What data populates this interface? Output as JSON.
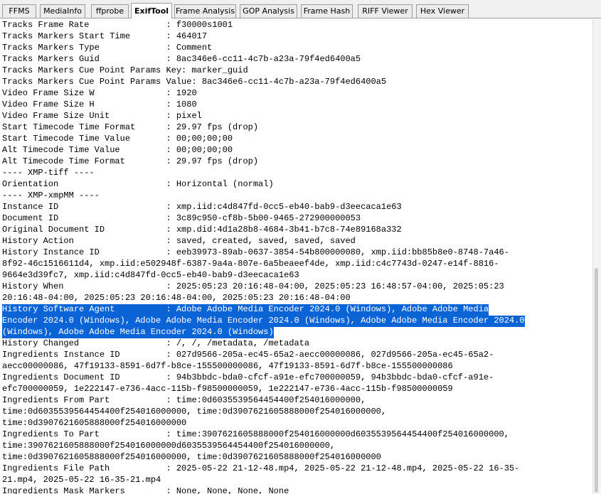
{
  "tabs": [
    {
      "label": "FFMS",
      "active": false
    },
    {
      "label": "MediaInfo",
      "active": false
    },
    {
      "label": "ffprobe",
      "active": false
    },
    {
      "label": "ExifTool",
      "active": true
    },
    {
      "label": "Frame Analysis",
      "active": false
    },
    {
      "label": "GOP Analysis",
      "active": false
    },
    {
      "label": "Frame Hash",
      "active": false
    },
    {
      "label": "RIFF Viewer",
      "active": false
    },
    {
      "label": "Hex Viewer",
      "active": false
    }
  ],
  "lines": [
    "Tracks Frame Rate               : f30000s1001",
    "Tracks Markers Start Time       : 464017",
    "Tracks Markers Type             : Comment",
    "Tracks Markers Guid             : 8ac346e6-cc11-4c7b-a23a-79f4ed6400a5",
    "Tracks Markers Cue Point Params Key: marker_guid",
    "Tracks Markers Cue Point Params Value: 8ac346e6-cc11-4c7b-a23a-79f4ed6400a5",
    "Video Frame Size W              : 1920",
    "Video Frame Size H              : 1080",
    "Video Frame Size Unit           : pixel",
    "Start Timecode Time Format      : 29.97 fps (drop)",
    "Start Timecode Time Value       : 00;00;00;00",
    "Alt Timecode Time Value         : 00;00;00;00",
    "Alt Timecode Time Format        : 29.97 fps (drop)",
    "---- XMP-tiff ----",
    "Orientation                     : Horizontal (normal)",
    "---- XMP-xmpMM ----",
    "Instance ID                     : xmp.iid:c4d847fd-0cc5-eb40-bab9-d3eecaca1e63",
    "Document ID                     : 3c89c950-cf8b-5b00-9465-272900000053",
    "Original Document ID            : xmp.did:4d1a28b8-4684-3b41-b7c8-74e89168a332",
    "History Action                  : saved, created, saved, saved, saved",
    "History Instance ID             : eeb39973-89ab-0637-3854-54b800000080, xmp.iid:bb85b8e0-8748-7a46-",
    "8f92-46c1516611d4, xmp.iid:e502948f-6387-9a4a-807e-6a5beaeef4de, xmp.iid:c4c7743d-0247-e14f-8816-",
    "9664e3d39fc7, xmp.iid:c4d847fd-0cc5-eb40-bab9-d3eecaca1e63",
    "History When                    : 2025:05:23 20:16:48-04:00, 2025:05:23 16:48:57-04:00, 2025:05:23",
    "20:16:48-04:00, 2025:05:23 20:16:48-04:00, 2025:05:23 20:16:48-04:00",
    "History Software Agent          : Adobe Adobe Media Encoder 2024.0 (Windows), Adobe Adobe Media",
    "Encoder 2024.0 (Windows), Adobe Adobe Media Encoder 2024.0 (Windows), Adobe Adobe Media Encoder 2024.0",
    "(Windows), Adobe Adobe Media Encoder 2024.0 (Windows)",
    "History Changed                 : /, /, /metadata, /metadata",
    "Ingredients Instance ID         : 027d9566-205a-ec45-65a2-aecc00000086, 027d9566-205a-ec45-65a2-",
    "aecc00000086, 47f19133-8591-6d7f-b8ce-155500000086, 47f19133-8591-6d7f-b8ce-155500000086",
    "Ingredients Document ID         : 94b3bbdc-bda0-cfcf-a91e-efc700000059, 94b3bbdc-bda0-cfcf-a91e-",
    "efc700000059, 1e222147-e736-4acc-115b-f98500000059, 1e222147-e736-4acc-115b-f98500000059",
    "Ingredients From Part           : time:0d6035539564454400f254016000000,",
    "time:0d6035539564454400f254016000000, time:0d3907621605888000f254016000000,",
    "time:0d3907621605888000f254016000000",
    "Ingredients To Part             : time:3907621605888000f254016000000d6035539564454400f254016000000,",
    "time:3907621605888000f254016000000d6035539564454400f254016000000,",
    "time:0d3907621605888000f254016000000, time:0d3907621605888000f254016000000",
    "Ingredients File Path           : 2025-05-22 21-12-48.mp4, 2025-05-22 21-12-48.mp4, 2025-05-22 16-35-",
    "21.mp4, 2025-05-22 16-35-21.mp4",
    "Ingredients Mask Markers        : None, None, None, None"
  ],
  "selected_lines": [
    25,
    26,
    27
  ],
  "colors": {
    "selection": "#0a64d6",
    "selection_text": "#ffffff"
  }
}
